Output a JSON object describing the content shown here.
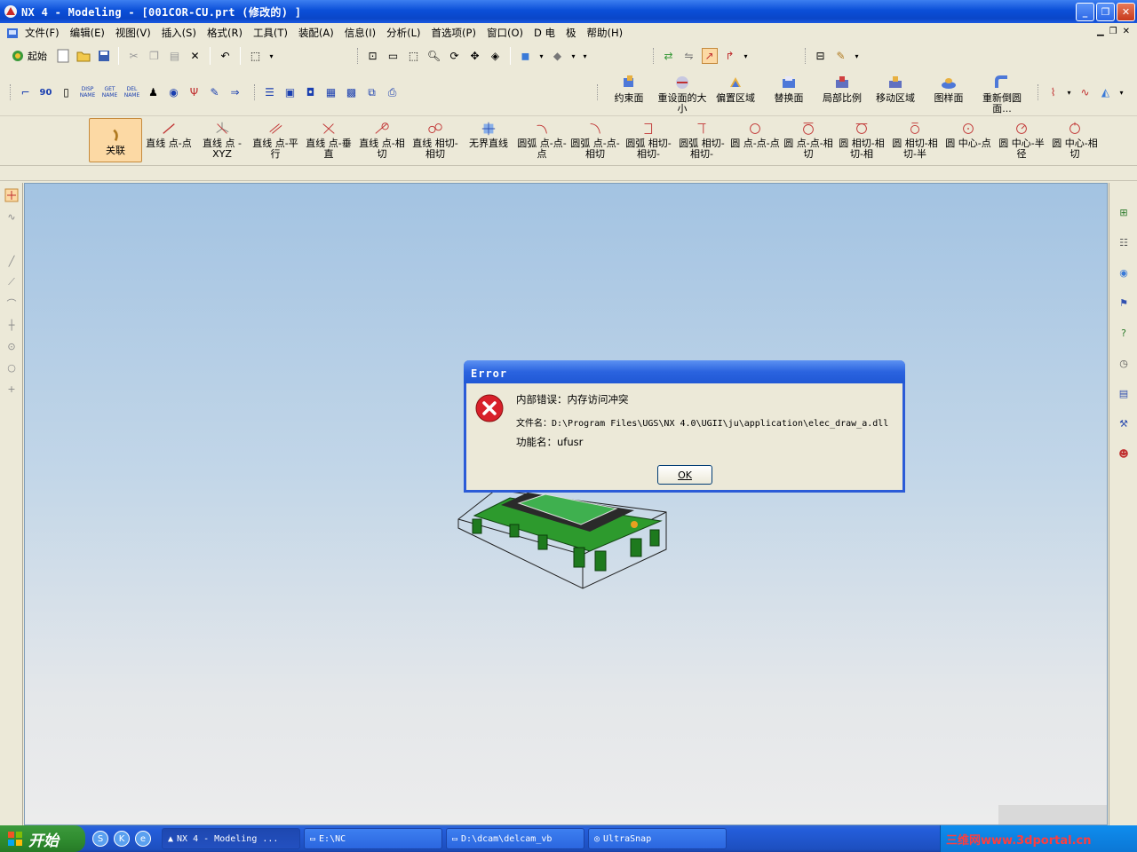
{
  "window": {
    "title": "NX 4 - Modeling - [001COR-CU.prt  (修改的) ]",
    "minimize": "_",
    "restore": "❐",
    "close": "✕"
  },
  "menu": [
    "文件(F)",
    "编辑(E)",
    "视图(V)",
    "插入(S)",
    "格式(R)",
    "工具(T)",
    "装配(A)",
    "信息(I)",
    "分析(L)",
    "首选项(P)",
    "窗口(O)",
    "D 电",
    "极",
    "帮助(H)"
  ],
  "standard_toolbar": {
    "start_label": "起始"
  },
  "custom_icon_text": {
    "disp": "DISP NAME",
    "get": "GET NAME",
    "del": "DEL NAME"
  },
  "sync_toolbar": [
    "约束面",
    "重设面的大小",
    "偏置区域",
    "替换面",
    "局部比例",
    "移动区域",
    "图样面",
    "重新倒圆面..."
  ],
  "sketch_toolbar": [
    "关联",
    "直线 点-点",
    "直线 点 -XYZ",
    "直线 点-平行",
    "直线 点-垂直",
    "直线 点-相切",
    "直线 相切-相切",
    "无界直线",
    "圆弧 点-点-点",
    "圆弧 点-点-相切",
    "圆弧 相切-相切-",
    "圆弧 相切-相切-",
    "圆 点-点-点",
    "圆 点-点-相切",
    "圆 相切-相切-相",
    "圆 相切-相切-半",
    "圆 中心-点",
    "圆 中心-半径",
    "圆 中心-相切"
  ],
  "dialog": {
    "title": "Error",
    "line1": "内部错误：内存访问冲突",
    "line2": "文件名：D:\\Program Files\\UGS\\NX 4.0\\UGII\\ju\\application\\elec_draw_a.dll",
    "line3": "功能名：ufusr",
    "ok": "OK"
  },
  "taskbar": {
    "start": "开始",
    "tasks": [
      "NX 4 - Modeling ...",
      "E:\\NC",
      "D:\\dcam\\delcam_vb",
      "UltraSnap"
    ],
    "tray_text": "三维网www.3dportal.cn"
  },
  "colors": {
    "title_blue": "#0b4fd8",
    "error_red": "#d8202a",
    "model_green": "#2d9a2d"
  }
}
